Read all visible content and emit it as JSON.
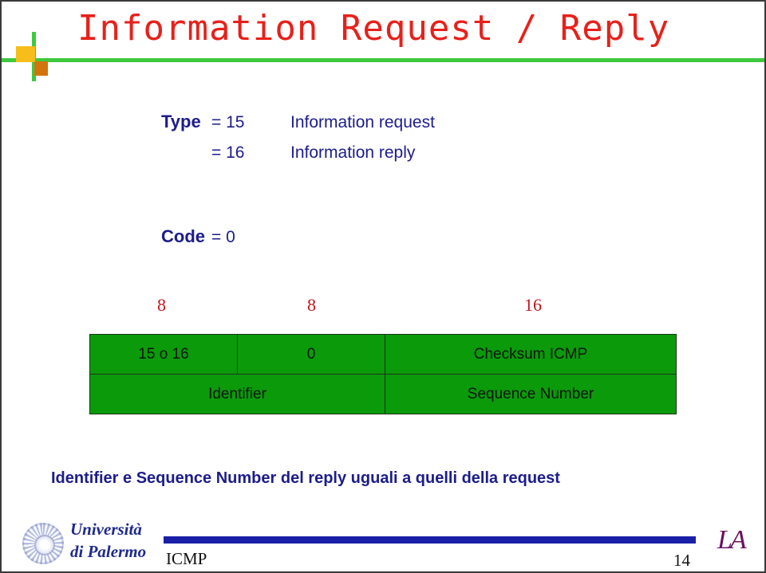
{
  "slide": {
    "title": "Information Request / Reply",
    "page_number": "14",
    "footer_label": "ICMP",
    "brand_mark": "LA",
    "accent_colors": {
      "title_red": "#e8201a",
      "rule_green": "#3ec93e",
      "square_yellow": "#f7bd1a",
      "square_orange": "#d2740c",
      "text_navy": "#1c1c8c",
      "bits_red": "#c0161c",
      "table_green": "#0a9a0a",
      "footer_bar_navy": "#1a1fa8",
      "brand_purple": "#6b1060"
    }
  },
  "fields": {
    "type_label": "Type",
    "type_rows": [
      {
        "value": "=  15",
        "meaning": "Information request"
      },
      {
        "value": "=  16",
        "meaning": "Information reply"
      }
    ],
    "code_label": "Code",
    "code_value": "=  0"
  },
  "packet": {
    "bit_widths": [
      "8",
      "8",
      "16"
    ],
    "rows": [
      {
        "cells": [
          {
            "text": "15  o  16",
            "span": 1
          },
          {
            "text": "0",
            "span": 1
          },
          {
            "text": "Checksum ICMP",
            "span": 1
          }
        ]
      },
      {
        "cells": [
          {
            "text": "Identifier",
            "span": 2
          },
          {
            "text": "Sequence Number",
            "span": 1
          }
        ]
      }
    ]
  },
  "note": "Identifier e Sequence Number del reply uguali a quelli della request",
  "institution": {
    "line1": "Università",
    "line2": "di Palermo"
  }
}
